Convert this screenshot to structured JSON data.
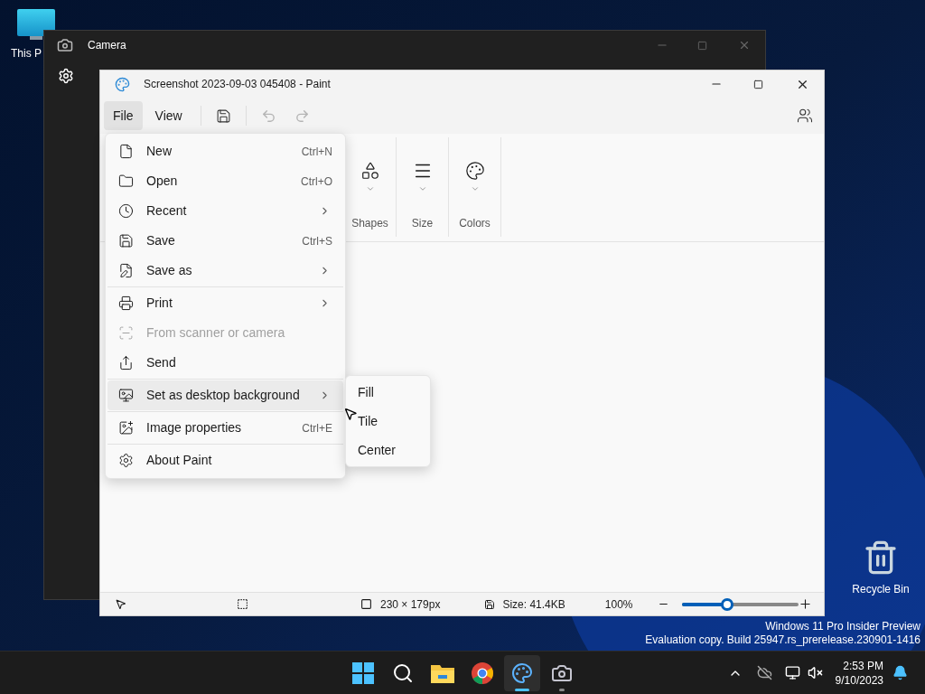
{
  "desktop": {
    "icons": [
      {
        "kind": "pc",
        "label": "This P"
      },
      {
        "kind": "bin",
        "label": "Recycle Bin"
      }
    ],
    "watermark": [
      "Windows 11 Pro Insider Preview",
      "Evaluation copy. Build 25947.rs_prerelease.230901-1416"
    ]
  },
  "camera_window": {
    "title": "Camera"
  },
  "paint_window": {
    "title": "Screenshot 2023-09-03 045408 - Paint",
    "menu_bar": [
      {
        "label": "File",
        "selected": true
      },
      {
        "label": "View",
        "selected": false
      }
    ],
    "toolbar": {
      "undo_disabled": true,
      "redo_disabled": true
    },
    "ribbon": [
      {
        "kind": "shapes",
        "label": "Shapes"
      },
      {
        "kind": "size",
        "label": "Size"
      },
      {
        "kind": "colors",
        "label": "Colors"
      }
    ],
    "status_bar": {
      "dimensions": "230 × 179px",
      "size": "Size: 41.4KB",
      "zoom": "100%",
      "zoom_slider": {
        "level": 0.38
      }
    }
  },
  "file_menu": [
    [
      {
        "kind": "new",
        "label": "New",
        "shortcut": "Ctrl+N",
        "submenu": false,
        "disabled": false,
        "selected": false
      },
      {
        "kind": "open",
        "label": "Open",
        "shortcut": "Ctrl+O",
        "submenu": false,
        "disabled": false,
        "selected": false
      },
      {
        "kind": "recent",
        "label": "Recent",
        "submenu": true,
        "disabled": false,
        "selected": false
      },
      {
        "kind": "save",
        "label": "Save",
        "shortcut": "Ctrl+S",
        "submenu": false,
        "disabled": false,
        "selected": false
      },
      {
        "kind": "saveas",
        "label": "Save as",
        "submenu": true,
        "disabled": false,
        "selected": false
      }
    ],
    [
      {
        "kind": "print",
        "label": "Print",
        "submenu": true,
        "disabled": false,
        "selected": false
      },
      {
        "kind": "scanner",
        "label": "From scanner or camera",
        "submenu": false,
        "disabled": true,
        "selected": false
      },
      {
        "kind": "send",
        "label": "Send",
        "submenu": false,
        "disabled": false,
        "selected": false
      }
    ],
    [
      {
        "kind": "background",
        "label": "Set as desktop background",
        "submenu": true,
        "disabled": false,
        "selected": true
      }
    ],
    [
      {
        "kind": "properties",
        "label": "Image properties",
        "shortcut": "Ctrl+E",
        "submenu": false,
        "disabled": false,
        "selected": false
      }
    ],
    [
      {
        "kind": "about",
        "label": "About Paint",
        "submenu": false,
        "disabled": false,
        "selected": false
      }
    ]
  ],
  "submenu": [
    {
      "label": "Fill"
    },
    {
      "label": "Tile"
    },
    {
      "label": "Center"
    }
  ],
  "taskbar": {
    "apps": [
      {
        "kind": "start",
        "running": false,
        "active": false
      },
      {
        "kind": "search",
        "running": false,
        "active": false
      },
      {
        "kind": "explorer",
        "running": false,
        "active": false
      },
      {
        "kind": "chrome",
        "running": false,
        "active": false
      },
      {
        "kind": "paint",
        "running": true,
        "active": true
      },
      {
        "kind": "camera",
        "running": true,
        "active": false
      }
    ],
    "time": "2:53 PM",
    "date": "9/10/2023"
  }
}
